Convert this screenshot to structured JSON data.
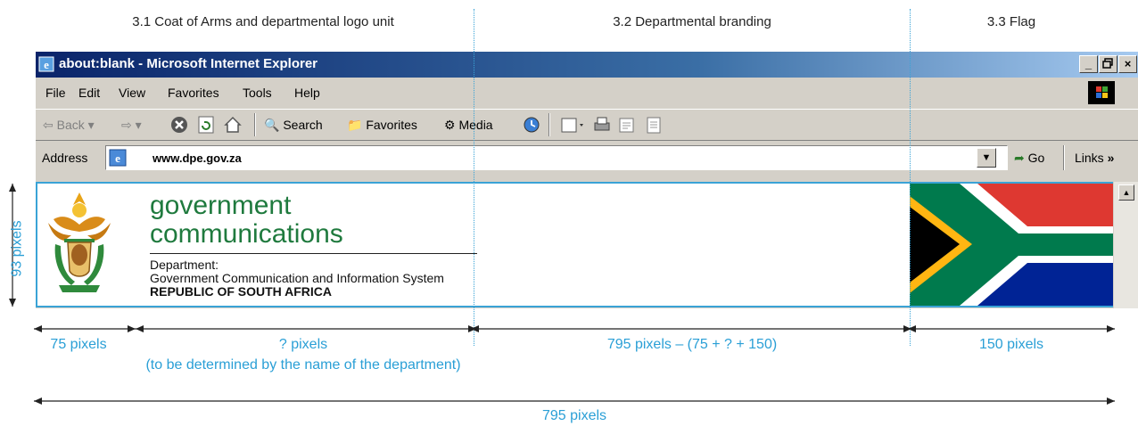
{
  "sections": {
    "coat_of_arms": "3.1 Coat of Arms and departmental logo unit",
    "branding": "3.2 Departmental branding",
    "flag": "3.3 Flag"
  },
  "browser": {
    "title": "about:blank - Microsoft Internet Explorer",
    "window_buttons": [
      "_",
      "×"
    ],
    "menu": [
      "File",
      "Edit",
      "View",
      "Favorites",
      "Tools",
      "Help"
    ],
    "toolbar": {
      "back": "Back",
      "search": "Search",
      "favorites": "Favorites",
      "media": "Media"
    },
    "address_label": "Address",
    "address_value": "www.dpe.gov.za",
    "go_label": "Go",
    "links_label": "Links",
    "links_chevron": "»"
  },
  "banner": {
    "brand_line1": "government",
    "brand_line2": "communications",
    "dept_label": "Department:",
    "dept_name": "Government Communication and Information System",
    "country": "REPUBLIC OF SOUTH AFRICA"
  },
  "dimensions": {
    "height": "93 pixels",
    "logo_width": "75 pixels",
    "name_width": "? pixels",
    "name_note": "(to be determined by the name of the department)",
    "branding_width": "795 pixels – (75 + ? + 150)",
    "flag_width": "150 pixels",
    "total_width": "795 pixels"
  },
  "colors": {
    "guide": "#3aa3d6",
    "brand_green": "#1f7a3e",
    "flag_red": "#de3831",
    "flag_blue": "#002395",
    "flag_green": "#007a4d",
    "flag_yellow": "#ffb612"
  }
}
